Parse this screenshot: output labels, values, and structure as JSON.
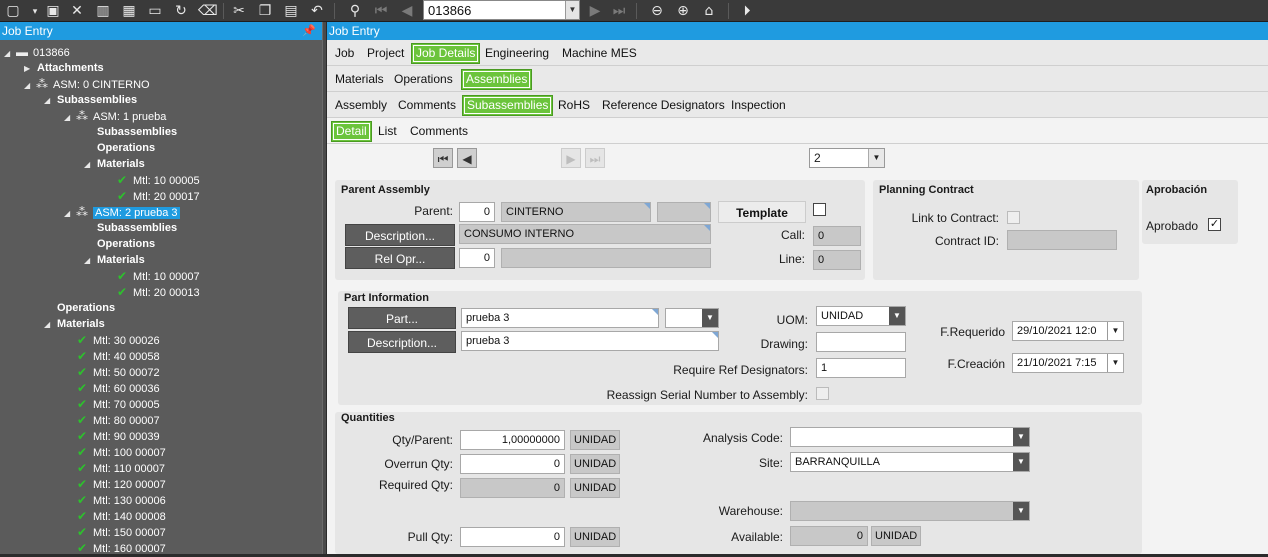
{
  "toolbar": {
    "job_number": "013866"
  },
  "tree": {
    "title": "Job Entry",
    "rows": [
      {
        "text": "013866"
      },
      {
        "text": "Attachments"
      },
      {
        "text": "ASM: 0 CINTERNO"
      },
      {
        "text": "Subassemblies"
      },
      {
        "text": "ASM: 1 prueba"
      },
      {
        "text": "Subassemblies"
      },
      {
        "text": "Operations"
      },
      {
        "text": "Materials"
      },
      {
        "text": "Mtl: 10 00005"
      },
      {
        "text": "Mtl: 20 00017"
      },
      {
        "text": "ASM: 2 prueba 3"
      },
      {
        "text": "Subassemblies"
      },
      {
        "text": "Operations"
      },
      {
        "text": "Materials"
      },
      {
        "text": "Mtl: 10 00007"
      },
      {
        "text": "Mtl: 20 00013"
      },
      {
        "text": "Operations"
      },
      {
        "text": "Materials"
      },
      {
        "text": "Mtl: 30 00026"
      },
      {
        "text": "Mtl: 40 00058"
      },
      {
        "text": "Mtl: 50 00072"
      },
      {
        "text": "Mtl: 60 00036"
      },
      {
        "text": "Mtl: 70 00005"
      },
      {
        "text": "Mtl: 80 00007"
      },
      {
        "text": "Mtl: 90 00039"
      },
      {
        "text": "Mtl: 100 00007"
      },
      {
        "text": "Mtl: 110 00007"
      },
      {
        "text": "Mtl: 120 00007"
      },
      {
        "text": "Mtl: 130 00006"
      },
      {
        "text": "Mtl: 140 00008"
      },
      {
        "text": "Mtl: 150 00007"
      },
      {
        "text": "Mtl: 160 00007"
      }
    ]
  },
  "main": {
    "title": "Job Entry",
    "tabs1": [
      "Job",
      "Project",
      "Job Details",
      "Engineering",
      "Machine MES"
    ],
    "tabs2": [
      "Materials",
      "Operations",
      "Assemblies"
    ],
    "tabs3": [
      "Assembly",
      "Comments",
      "Subassemblies",
      "RoHS",
      "Reference Designators",
      "Inspection"
    ],
    "tabs4": [
      "Detail",
      "List",
      "Comments"
    ],
    "nav_value": "2"
  },
  "parent_assembly": {
    "title": "Parent Assembly",
    "parent_label": "Parent:",
    "parent_value": "0",
    "parent_desc": "CINTERNO",
    "template_label": "Template",
    "description_btn": "Description...",
    "description_value": "CONSUMO INTERNO",
    "rel_opr_btn": "Rel Opr...",
    "rel_opr_value": "0",
    "call_label": "Call:",
    "call_value": "0",
    "line_label": "Line:",
    "line_value": "0"
  },
  "planning_contract": {
    "title": "Planning Contract",
    "link_label": "Link to Contract:",
    "contract_id_label": "Contract ID:"
  },
  "aprobacion": {
    "title": "Aprobación",
    "aprobado_label": "Aprobado",
    "aprobado_checked": "✓"
  },
  "part_info": {
    "title": "Part Information",
    "part_btn": "Part...",
    "part_value": "prueba 3",
    "description_btn": "Description...",
    "description_value": "prueba 3",
    "uom_label": "UOM:",
    "uom_value": "UNIDAD",
    "drawing_label": "Drawing:",
    "req_ref_label": "Require Ref Designators:",
    "req_ref_value": "1",
    "reassign_label": "Reassign Serial Number to Assembly:",
    "frequerido_label": "F.Requerido",
    "frequerido_value": "29/10/2021 12:0",
    "fcreacion_label": "F.Creación",
    "fcreacion_value": "21/10/2021 7:15"
  },
  "quantities": {
    "title": "Quantities",
    "qty_parent_label": "Qty/Parent:",
    "qty_parent_value": "1,00000000",
    "overrun_label": "Overrun Qty:",
    "overrun_value": "0",
    "required_label": "Required Qty:",
    "required_value": "0",
    "pull_label": "Pull Qty:",
    "pull_value": "0",
    "unit": "UNIDAD",
    "analysis_label": "Analysis Code:",
    "site_label": "Site:",
    "site_value": "BARRANQUILLA",
    "warehouse_label": "Warehouse:",
    "available_label": "Available:",
    "available_value": "0"
  }
}
